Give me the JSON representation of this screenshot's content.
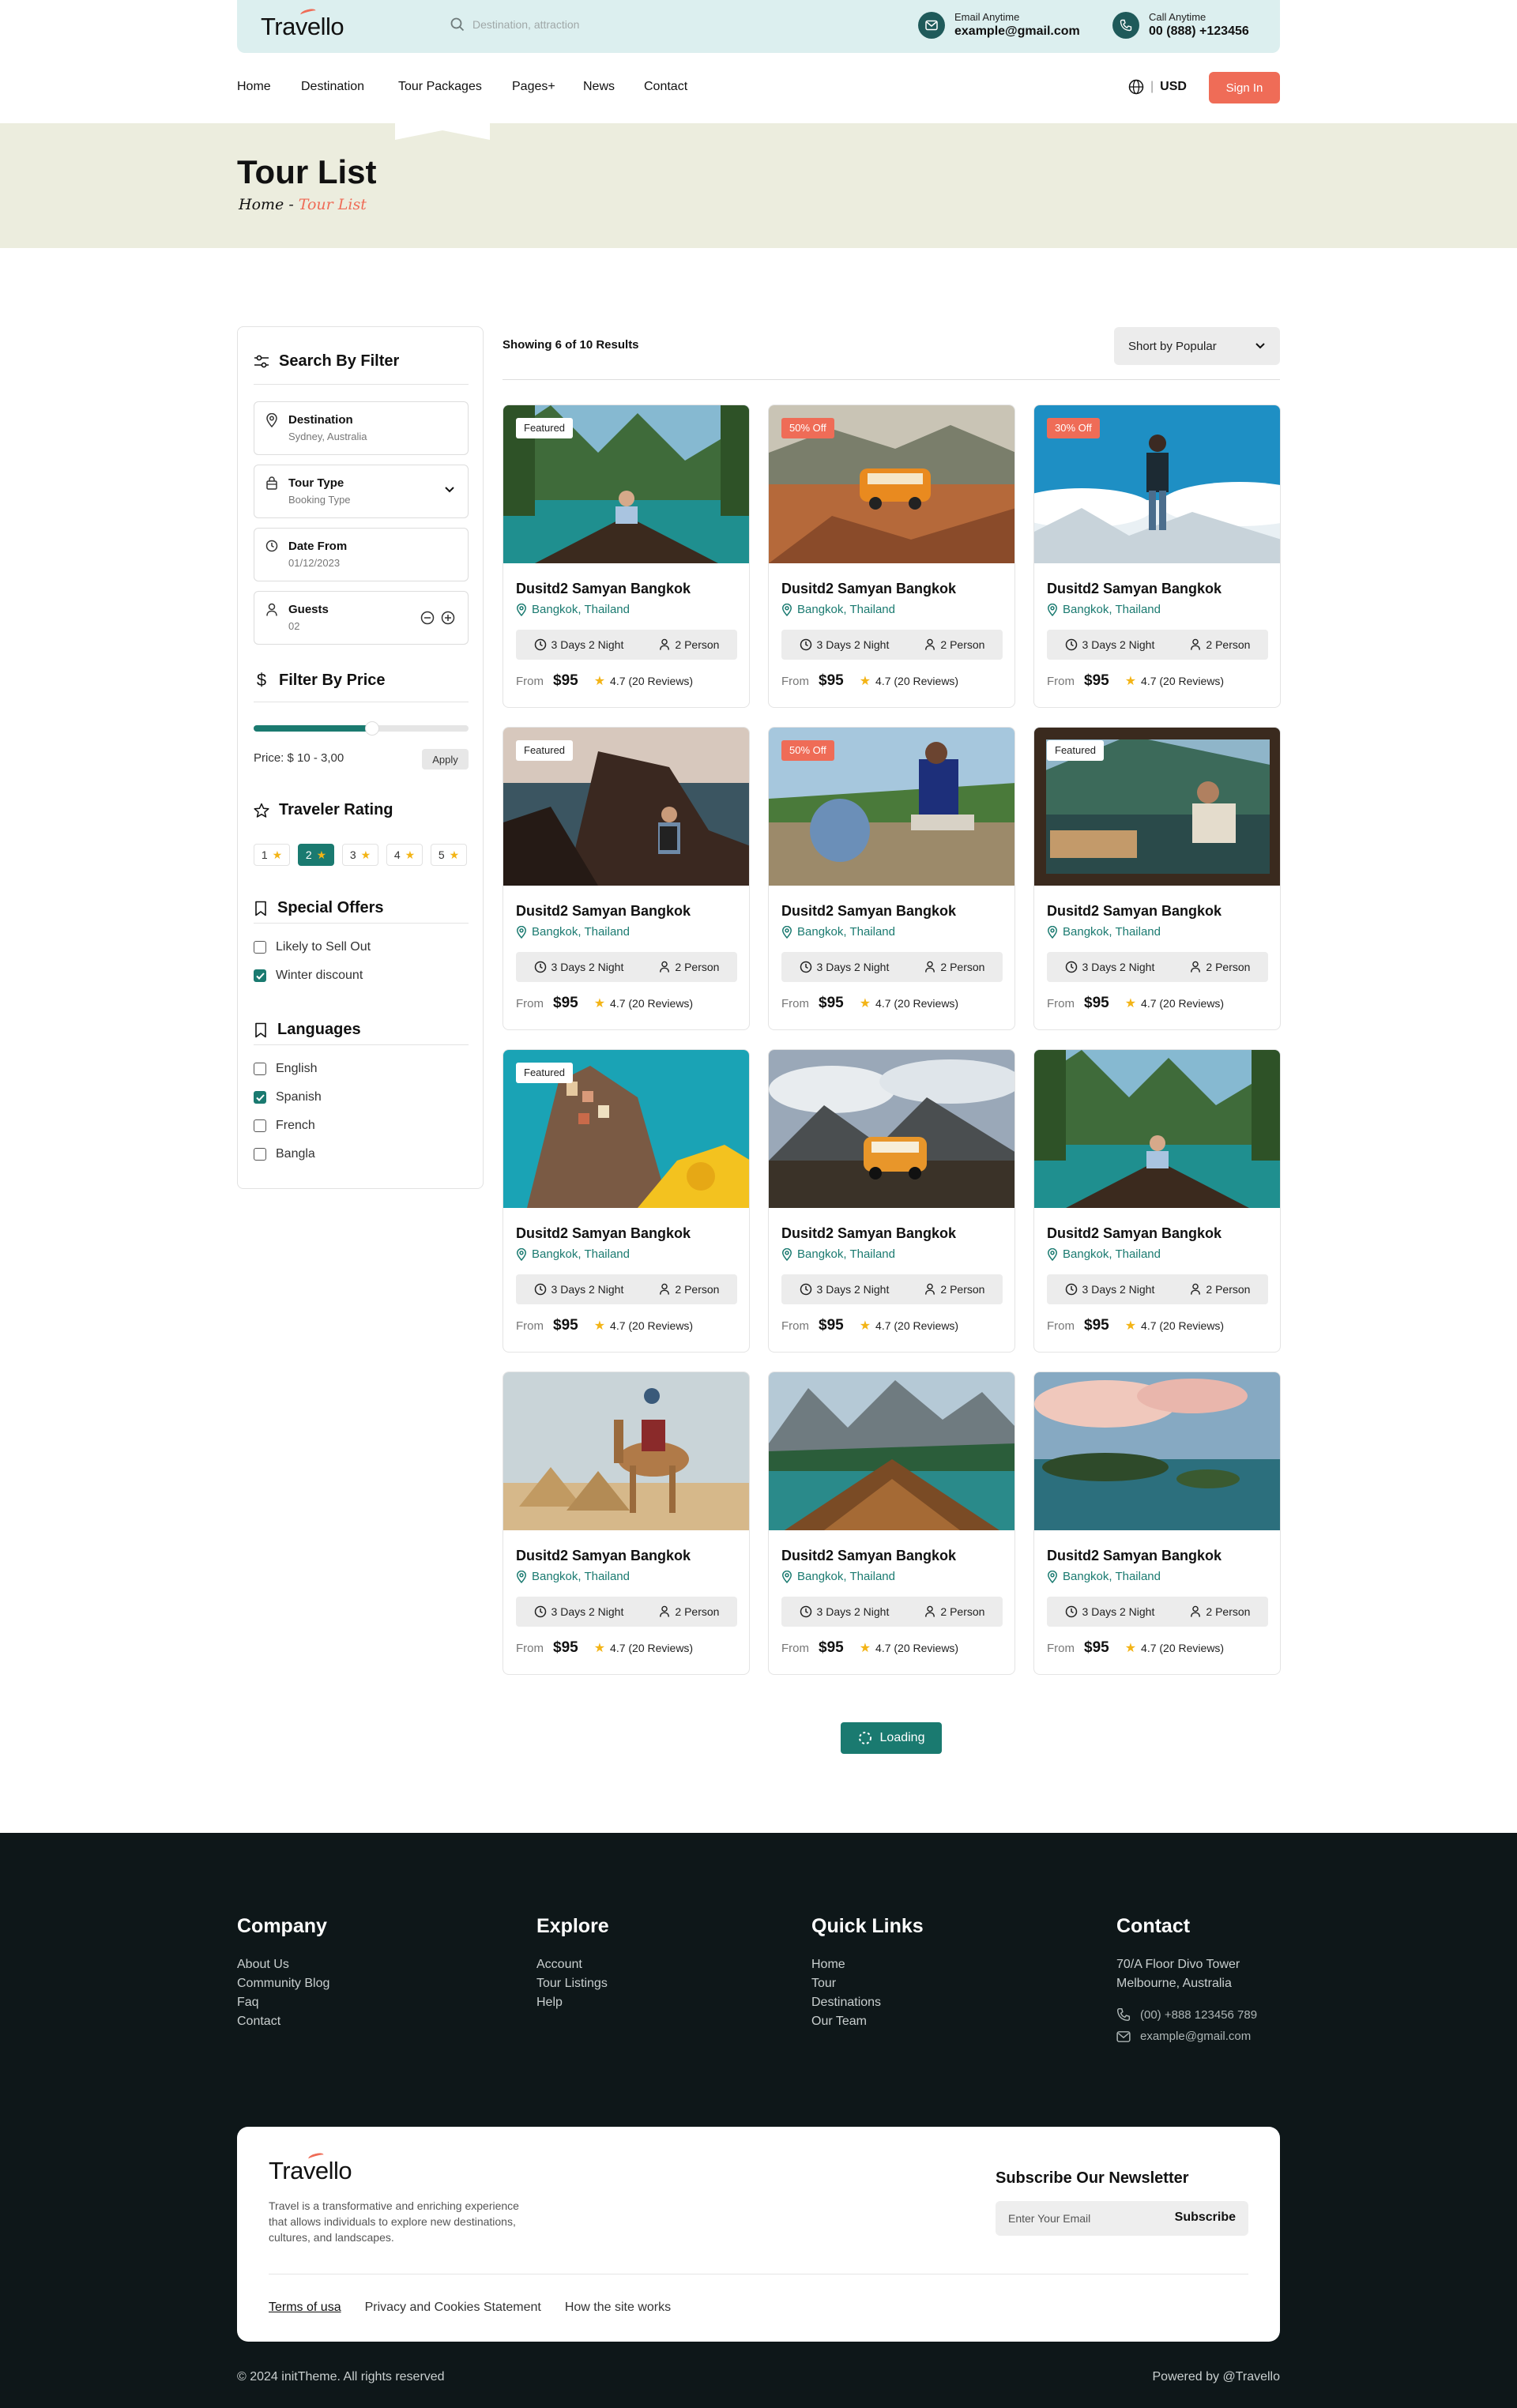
{
  "brand": {
    "name": "Travello",
    "accent": "#ef6c57",
    "primary": "#1a7a70"
  },
  "header": {
    "search_placeholder": "Destination, attraction",
    "email_label": "Email Anytime",
    "email_value": "example@gmail.com",
    "call_label": "Call Anytime",
    "call_value": "00 (888) +123456"
  },
  "nav": {
    "items": [
      "Home",
      "Destination",
      "Tour Packages",
      "Pages+",
      "News",
      "Contact"
    ],
    "active": "Tour Packages",
    "currency": "USD",
    "signin": "Sign In"
  },
  "banner": {
    "title": "Tour List",
    "crumb_home": "Home",
    "crumb_sep": " - ",
    "crumb_current": "Tour List"
  },
  "filter": {
    "heading": "Search By Filter",
    "fields": [
      {
        "title": "Destination",
        "sub": "Sydney, Australia",
        "icon": "map-pin-icon"
      },
      {
        "title": "Tour Type",
        "sub": "Booking Type",
        "icon": "bag-icon"
      },
      {
        "title": "Date From",
        "sub": "01/12/2023",
        "icon": "clock-icon"
      },
      {
        "title": "Guests",
        "sub": "02",
        "icon": "user-icon"
      }
    ],
    "price_heading": "Filter By Price",
    "price_fill": 0.55,
    "price_text": "Price: $ 10 - 3,00",
    "apply": "Apply",
    "rating_heading": "Traveler Rating",
    "ratings": [
      "1",
      "2",
      "3",
      "4",
      "5"
    ],
    "rating_active": "2",
    "offers_heading": "Special Offers",
    "offers": [
      {
        "label": "Likely to Sell Out",
        "checked": false
      },
      {
        "label": "Winter discount",
        "checked": true
      }
    ],
    "lang_heading": "Languages",
    "languages": [
      {
        "label": "English",
        "checked": false
      },
      {
        "label": "Spanish",
        "checked": true
      },
      {
        "label": "French",
        "checked": false
      },
      {
        "label": "Bangla",
        "checked": false
      }
    ]
  },
  "results": {
    "showing": "Showing 6 of 10 Results",
    "sort": "Short by Popular",
    "loading": "Loading"
  },
  "tours": [
    {
      "badge": "Featured",
      "badge_type": "f",
      "title": "Dusitd2 Samyan Bangkok",
      "location": "Bangkok, Thailand",
      "duration": "3 Days 2 Night",
      "persons": "2 Person",
      "from": "From",
      "price": "$95",
      "rating": "4.7 (20 Reviews)",
      "scene": "lake-boat"
    },
    {
      "badge": "50% Off",
      "badge_type": "o",
      "title": "Dusitd2 Samyan Bangkok",
      "location": "Bangkok, Thailand",
      "duration": "3 Days 2 Night",
      "persons": "2 Person",
      "from": "From",
      "price": "$95",
      "rating": "4.7 (20 Reviews)",
      "scene": "van-rocks"
    },
    {
      "badge": "30% Off",
      "badge_type": "o",
      "title": "Dusitd2 Samyan Bangkok",
      "location": "Bangkok, Thailand",
      "duration": "3 Days 2 Night",
      "persons": "2 Person",
      "from": "From",
      "price": "$95",
      "rating": "4.7 (20 Reviews)",
      "scene": "hiker-clouds"
    },
    {
      "badge": "Featured",
      "badge_type": "f",
      "title": "Dusitd2 Samyan Bangkok",
      "location": "Bangkok, Thailand",
      "duration": "3 Days 2 Night",
      "persons": "2 Person",
      "from": "From",
      "price": "$95",
      "rating": "4.7 (20 Reviews)",
      "scene": "cliff-sea"
    },
    {
      "badge": "50% Off",
      "badge_type": "o",
      "title": "Dusitd2 Samyan Bangkok",
      "location": "Bangkok, Thailand",
      "duration": "3 Days 2 Night",
      "persons": "2 Person",
      "from": "From",
      "price": "$95",
      "rating": "4.7 (20 Reviews)",
      "scene": "hiker-rest"
    },
    {
      "badge": "Featured",
      "badge_type": "f",
      "title": "Dusitd2 Samyan Bangkok",
      "location": "Bangkok, Thailand",
      "duration": "3 Days 2 Night",
      "persons": "2 Person",
      "from": "From",
      "price": "$95",
      "rating": "4.7 (20 Reviews)",
      "scene": "window-view"
    },
    {
      "badge": "Featured",
      "badge_type": "f",
      "title": "Dusitd2 Samyan Bangkok",
      "location": "Bangkok, Thailand",
      "duration": "3 Days 2 Night",
      "persons": "2 Person",
      "from": "From",
      "price": "$95",
      "rating": "4.7 (20 Reviews)",
      "scene": "coast-town"
    },
    {
      "badge": "",
      "badge_type": "",
      "title": "Dusitd2 Samyan Bangkok",
      "location": "Bangkok, Thailand",
      "duration": "3 Days 2 Night",
      "persons": "2 Person",
      "from": "From",
      "price": "$95",
      "rating": "4.7 (20 Reviews)",
      "scene": "van-road"
    },
    {
      "badge": "",
      "badge_type": "",
      "title": "Dusitd2 Samyan Bangkok",
      "location": "Bangkok, Thailand",
      "duration": "3 Days 2 Night",
      "persons": "2 Person",
      "from": "From",
      "price": "$95",
      "rating": "4.7 (20 Reviews)",
      "scene": "lake-boat"
    },
    {
      "badge": "",
      "badge_type": "",
      "title": "Dusitd2 Samyan Bangkok",
      "location": "Bangkok, Thailand",
      "duration": "3 Days 2 Night",
      "persons": "2 Person",
      "from": "From",
      "price": "$95",
      "rating": "4.7 (20 Reviews)",
      "scene": "camel-pyramids"
    },
    {
      "badge": "",
      "badge_type": "",
      "title": "Dusitd2 Samyan Bangkok",
      "location": "Bangkok, Thailand",
      "duration": "3 Days 2 Night",
      "persons": "2 Person",
      "from": "From",
      "price": "$95",
      "rating": "4.7 (20 Reviews)",
      "scene": "boat-mountains"
    },
    {
      "badge": "",
      "badge_type": "",
      "title": "Dusitd2 Samyan Bangkok",
      "location": "Bangkok, Thailand",
      "duration": "3 Days 2 Night",
      "persons": "2 Person",
      "from": "From",
      "price": "$95",
      "rating": "4.7 (20 Reviews)",
      "scene": "island-sunset"
    }
  ],
  "footer": {
    "company": {
      "title": "Company",
      "links": [
        "About Us",
        "Community Blog",
        "Faq",
        "Contact"
      ]
    },
    "explore": {
      "title": "Explore",
      "links": [
        "Account",
        "Tour Listings",
        "Help"
      ]
    },
    "quick": {
      "title": "Quick Links",
      "links": [
        "Home",
        "Tour",
        "Destinations",
        "Our Team"
      ]
    },
    "contact": {
      "title": "Contact",
      "address1": "70/A Floor Divo Tower",
      "address2": "Melbourne, Australia",
      "phone": "(00) +888 123456 789",
      "email": "example@gmail.com"
    },
    "desc": "Travel is a transformative and enriching experience that allows individuals to explore new destinations, cultures, and landscapes.",
    "newsletter_title": "Subscribe Our Newsletter",
    "newsletter_placeholder": "Enter Your Email",
    "subscribe": "Subscribe",
    "legal": [
      "Terms of usa",
      "Privacy and Cookies Statement",
      "How the site works"
    ],
    "copyright": "© 2024 initTheme. All rights reserved",
    "powered": "Powered by @Travello"
  }
}
